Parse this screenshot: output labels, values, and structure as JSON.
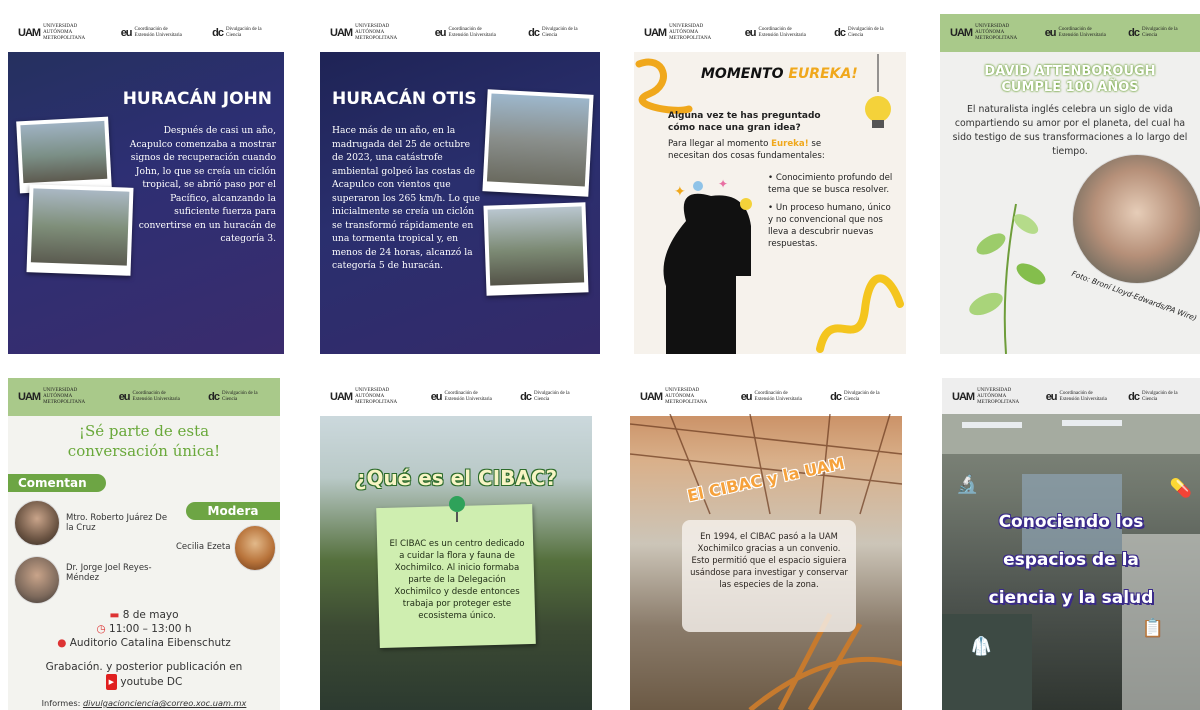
{
  "logos": {
    "uam_mark": "UAM",
    "uam_name": "UNIVERSIDAD AUTÓNOMA METROPOLITANA",
    "uam_unit": "Unidad Xochimilco",
    "ceu_mark": "eu",
    "ceu_name": "Coordinación de Extensión Universitaria",
    "dc_mark": "dc",
    "dc_name": "Divulgación de la Ciencia"
  },
  "tiles": [
    {
      "title": "HURACÁN JOHN",
      "body": "Después de casi un año, Acapulco comenzaba a mostrar signos de recuperación cuando John, lo que se creía un ciclón tropical, se abrió paso por el Pacífico, alcanzando la suficiente fuerza para convertirse en un huracán de categoría 3."
    },
    {
      "title": "HURACÁN OTIS",
      "body": "Hace más de un año, en la madrugada del 25 de octubre de 2023, una catástrofe ambiental golpeó las costas de Acapulco con vientos que superaron los 265 km/h. Lo que inicialmente se creía un ciclón se transformó rápidamente en una tormenta tropical y, en menos de 24 horas, alcanzó la categoría 5 de huracán."
    },
    {
      "title_a": "MOMENTO ",
      "title_b": "EUREKA",
      "title_c": "!",
      "question": "Alguna vez te has preguntado cómo nace una gran idea?",
      "intro_a": "Para llegar al momento ",
      "intro_b": "Eureka!",
      "intro_c": " se necesitan dos cosas fundamentales:",
      "bullets": [
        "Conocimiento profundo del tema que se busca resolver.",
        "Un proceso humano, único y no convencional que nos lleva a descubrir nuevas respuestas."
      ]
    },
    {
      "title_1": "DAVID ATTENBOROUGH",
      "title_2": "CUMPLE 100 AÑOS",
      "body": "El naturalista inglés celebra un siglo de vida compartiendo su amor por el planeta, del cual ha sido testigo de sus transformaciones a lo largo del tiempo.",
      "credit": "Foto: Broní Lloyd-Edwards/PA Wire)"
    },
    {
      "title_1": "¡Sé parte de esta",
      "title_2": "conversación única!",
      "comentan": "Comentan",
      "modera": "Modera",
      "speaker_1": "Mtro. Roberto Juárez De la Cruz",
      "speaker_2": "Dr. Jorge Joel Reyes-Méndez",
      "moderator": "Cecilia Ezeta",
      "date": "8 de mayo",
      "time": "11:00 – 13:00 h",
      "place": "Auditorio Catalina Eibenschutz",
      "recording": "Grabación. y posterior publicación en",
      "channel": "youtube DC",
      "informes_label": "Informes:",
      "email": "divulgacionciencia@correo.xoc.uam.mx"
    },
    {
      "title": "¿Qué es el CIBAC?",
      "body": "El CIBAC es un centro dedicado a cuidar la flora y fauna de Xochimilco. Al inicio formaba parte de la Delegación Xochimilco y desde entonces trabaja por proteger este ecosistema único."
    },
    {
      "title": "El CIBAC y la UAM",
      "body": "En 1994, el CIBAC pasó a la UAM Xochimilco gracias a un convenio. Esto permitió que el espacio siguiera usándose para investigar y conservar las especies de la zona."
    },
    {
      "title_1": "Conociendo los",
      "title_2": "espacios de la",
      "title_3": "ciencia y la salud"
    }
  ],
  "icons": [
    "microscope-icon",
    "pill-icon",
    "lab-coat-icon",
    "clipboard-icon",
    "calendar-icon",
    "clock-icon",
    "location-pin-icon",
    "youtube-icon",
    "lightbulb-icon",
    "pushpin-icon"
  ],
  "colors": {
    "green": "#6da544",
    "eureka_orange": "#f0a81c",
    "night_blue": "#2d2f73",
    "lab_purple": "#3a2a8a"
  }
}
